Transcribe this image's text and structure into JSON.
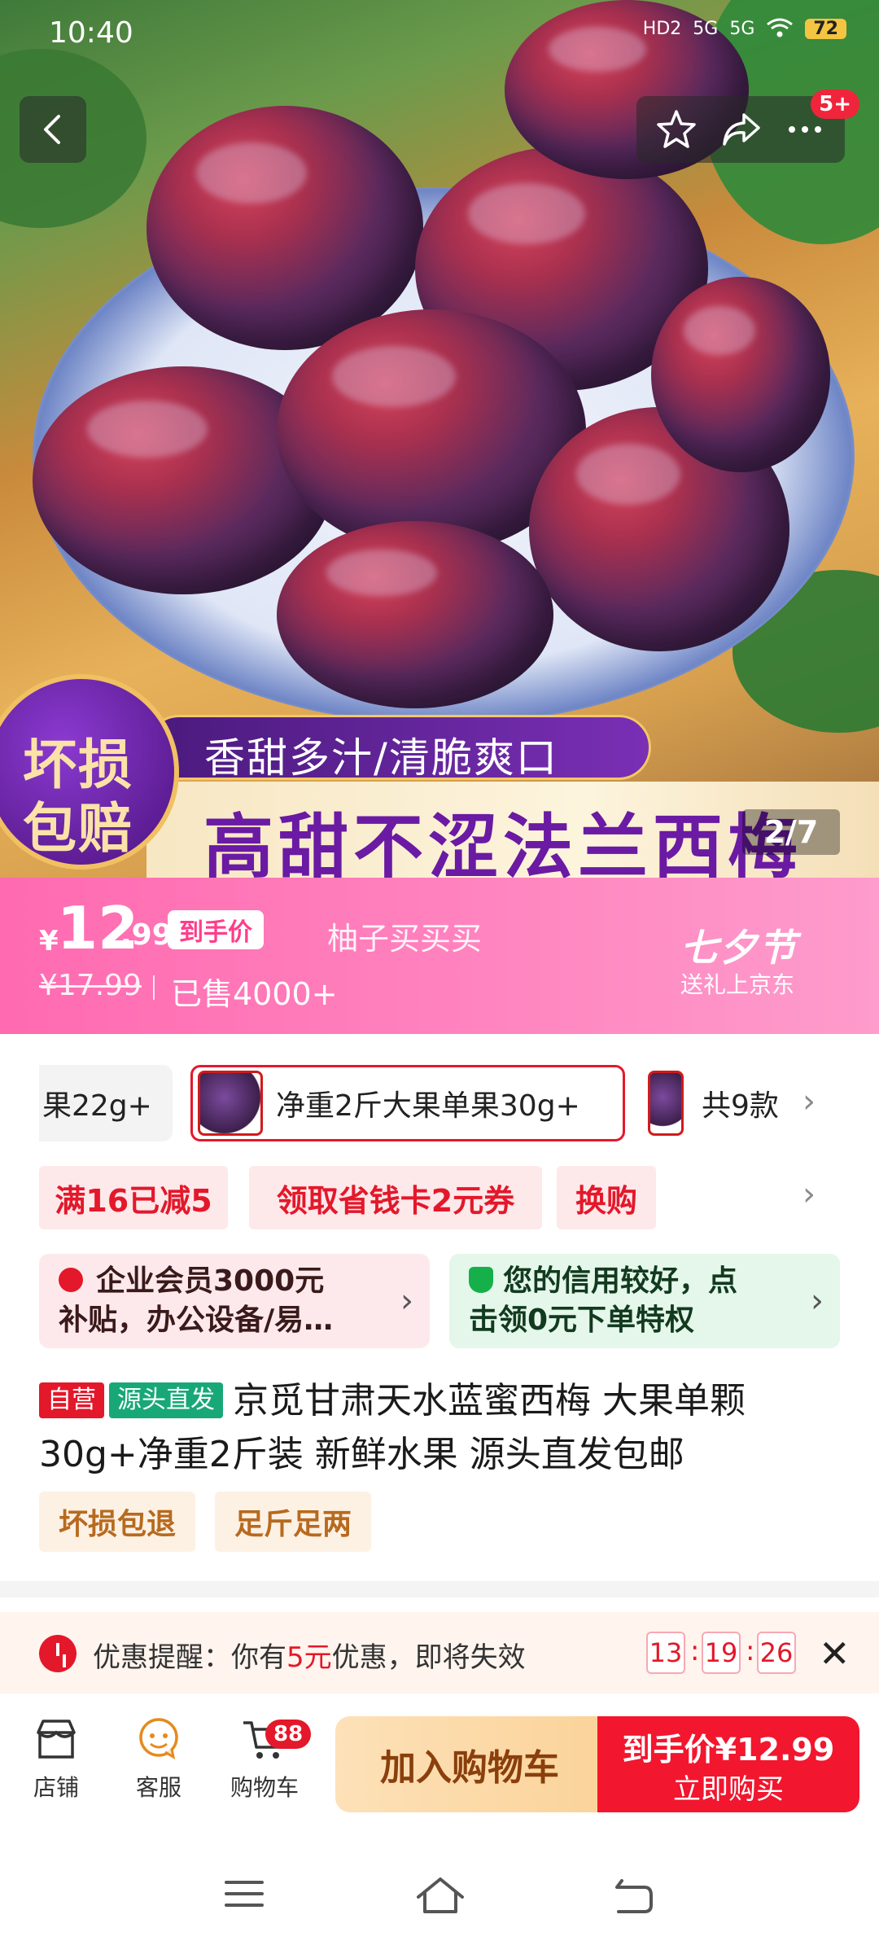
{
  "status_bar": {
    "time": "10:40",
    "network": [
      "HD2",
      "5G",
      "5G"
    ],
    "battery": "72"
  },
  "header": {
    "back_icon": "back-arrow-icon",
    "actions": [
      "star-icon",
      "share-icon",
      "more-icon"
    ],
    "more_badge": "5+"
  },
  "hero": {
    "circle_badge": [
      "坏损",
      "包赔"
    ],
    "slogan_top": "香甜多汁/清脆爽口",
    "slogan_main": "高甜不涩法兰西梅",
    "page_indicator": "2/7"
  },
  "price": {
    "currency": "¥",
    "integer": "12",
    "decimal": ".99",
    "tag": "到手价",
    "shop": "柚子买买买",
    "original": "¥17.99",
    "sold": "已售4000+",
    "festival": "七夕节",
    "festival_sub": "送礼上京东"
  },
  "specs": {
    "items": [
      "果22g+",
      "净重2斤大果单果30g+",
      "共9款"
    ]
  },
  "coupons": [
    "满16已减5",
    "领取省钱卡2元券",
    "换购"
  ],
  "cards": {
    "member_line1": "企业会员3000元",
    "member_line2": "补贴，办公设备/易…",
    "credit_line1": "您的信用较好，点",
    "credit_line2": "击领0元下单特权"
  },
  "product": {
    "tag_self": "自营",
    "tag_source": "源头直发",
    "title": "京觅甘肃天水蓝蜜西梅 大果单颗30g+净重2斤装 新鲜水果 源头直发包邮"
  },
  "services": [
    "坏损包退",
    "足斤足两"
  ],
  "reminder": {
    "prefix": "优惠提醒：你有",
    "amount": "5元",
    "suffix": "优惠，即将失效",
    "hh": "13",
    "mm": "19",
    "ss": "26"
  },
  "bottom_bar": {
    "shop": "店铺",
    "service": "客服",
    "cart": "购物车",
    "cart_badge": "88",
    "add_cart": "加入购物车",
    "buy_line1": "到手价¥12.99",
    "buy_line2": "立即购买"
  },
  "colors": {
    "accent_red": "#e3182a",
    "price_pink": "#ff6ab0",
    "brand_purple": "#6a1aa3"
  }
}
